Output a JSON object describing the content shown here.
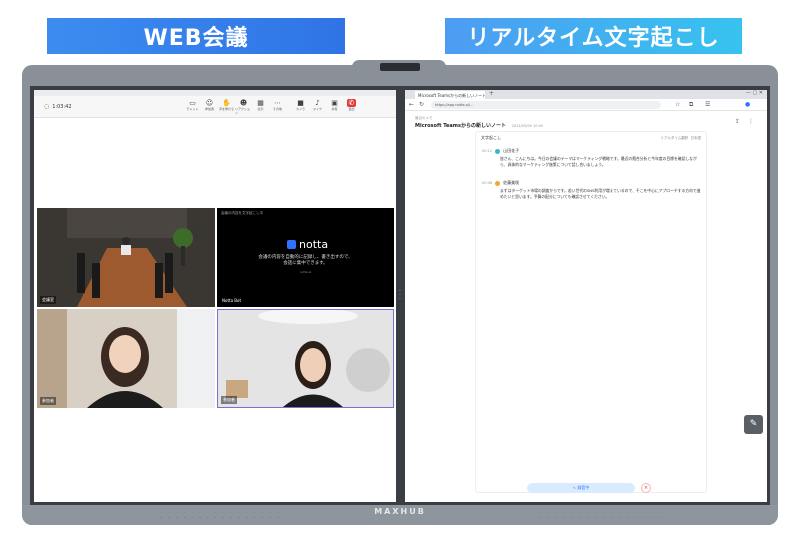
{
  "banners": {
    "left": "WEB会議",
    "right": "リアルタイム文字起こし"
  },
  "device": {
    "brand": "MAXHUB"
  },
  "meeting": {
    "title": "1:03:42",
    "toolbar": [
      {
        "icon": "chat-icon",
        "label": "チャット"
      },
      {
        "icon": "people-icon",
        "label": "参加者"
      },
      {
        "icon": "hand-icon",
        "label": "手を挙げる"
      },
      {
        "icon": "reaction-icon",
        "label": "リアクション"
      },
      {
        "icon": "view-icon",
        "label": "表示"
      },
      {
        "icon": "more-icon",
        "label": "その他"
      },
      {
        "icon": "camera-icon",
        "label": "カメラ"
      },
      {
        "icon": "mic-icon",
        "label": "マイク"
      },
      {
        "icon": "share-icon",
        "label": "共有"
      },
      {
        "icon": "leave-icon",
        "label": "退出"
      }
    ],
    "tiles": {
      "conference_label": "会議室",
      "notta_header": "会議の内容を文字起こし中",
      "notta_brand": "notta",
      "notta_message": "会議の内容を自動的に記録し、書き出すので、\n会話に集中できます。",
      "notta_sub": "notta.ai",
      "notta_tag": "Notta Bot",
      "person1_tag": "参加者",
      "person2_tag": "参加者"
    }
  },
  "browser": {
    "tab_title": "Microsoft Teamsからの新しいノート",
    "url": "https://app.notta.ai/..."
  },
  "notta": {
    "breadcrumb": "最近のメモ",
    "note_title": "Microsoft Teamsからの新しいノート",
    "note_date": "2024/05/09 10:00",
    "section_label": "文字起こし",
    "mode_label": "リアルタイム翻訳",
    "mode_value": "日本語",
    "entries": [
      {
        "time": "00:12",
        "speaker": "山田花子",
        "text": "皆さん、こんにちは。今日の会議のテーマはマーケティング戦略です。最近の競合分析と今年度の目標を確認しながら、具体的なマーケティング施策について話し合いましょう。"
      },
      {
        "time": "00:48",
        "speaker": "佐藤美咲",
        "text": "まずはターゲット市場の調査からです。若い世代のSNS利用が増えているので、そこを中心にアプローチする方向で進めたいと思います。予算の配分についても確認させてください。"
      }
    ],
    "recording_label": "録音中",
    "stop_label": "×"
  },
  "colors": {
    "banner_left": "#2f74e6",
    "banner_right": "#37c3ef",
    "notta_blue": "#2e72ff"
  }
}
